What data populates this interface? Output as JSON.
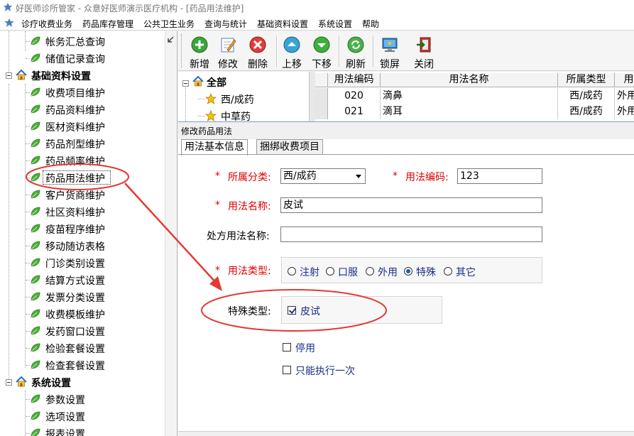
{
  "window": {
    "title": "好医师诊所管家 - 众意好医师演示医疗机构 - [药品用法维护]"
  },
  "menu": {
    "items": [
      "诊疗收费业务",
      "药品库存管理",
      "公共卫生业务",
      "查询与统计",
      "基础资料设置",
      "系统设置",
      "帮助"
    ]
  },
  "sidebar": {
    "items": [
      {
        "label": "帐务汇总查询"
      },
      {
        "label": "储值记录查询"
      },
      {
        "label": "基础资料设置"
      },
      {
        "label": "收费项目维护"
      },
      {
        "label": "药品资料维护"
      },
      {
        "label": "医材资料维护"
      },
      {
        "label": "药品剂型维护"
      },
      {
        "label": "药品频率维护"
      },
      {
        "label": "药品用法维护"
      },
      {
        "label": "客户货商维护"
      },
      {
        "label": "社区资料维护"
      },
      {
        "label": "疫苗程序维护"
      },
      {
        "label": "移动随访表格"
      },
      {
        "label": "门诊类别设置"
      },
      {
        "label": "结算方式设置"
      },
      {
        "label": "发票分类设置"
      },
      {
        "label": "收费模板维护"
      },
      {
        "label": "发药窗口设置"
      },
      {
        "label": "检验套餐设置"
      },
      {
        "label": "检查套餐设置"
      },
      {
        "label": "系统设置"
      },
      {
        "label": "参数设置"
      },
      {
        "label": "选项设置"
      },
      {
        "label": "报表设置"
      }
    ]
  },
  "toolbar": {
    "buttons": [
      "新增",
      "修改",
      "删除",
      "上移",
      "下移",
      "刷新",
      "锁屏",
      "关闭"
    ]
  },
  "category_tree": {
    "root": "全部",
    "items": [
      "西/成药",
      "中草药"
    ]
  },
  "grid": {
    "columns": [
      "用法编码",
      "用法名称",
      "所属类型",
      "用"
    ],
    "rows": [
      [
        "020",
        "滴鼻",
        "西/成药",
        "外用"
      ],
      [
        "021",
        "滴耳",
        "西/成药",
        "外用"
      ]
    ]
  },
  "dialog": {
    "title": "修改药品用法",
    "tabs": [
      "用法基本信息",
      "捆绑收费项目"
    ],
    "required_mark": "*",
    "category_label": "所属分类:",
    "category_value": "西/成药",
    "code_label": "用法编码:",
    "code_value": "123",
    "name_label": "用法名称:",
    "name_value": "皮试",
    "rx_name_label": "处方用法名称:",
    "rx_name_value": "",
    "type_label": "用法类型:",
    "type_options": [
      "注射",
      "口服",
      "外用",
      "特殊",
      "其它"
    ],
    "type_selected": "特殊",
    "special_label": "特殊类型:",
    "special_option": "皮试",
    "special_checked": true,
    "disabled_label": "停用",
    "disabled_checked": false,
    "once_label": "只能执行一次",
    "once_checked": false
  },
  "colors": {
    "required": "#e00000",
    "annotation": "#e53935",
    "option_text": "#1a2e8a"
  }
}
